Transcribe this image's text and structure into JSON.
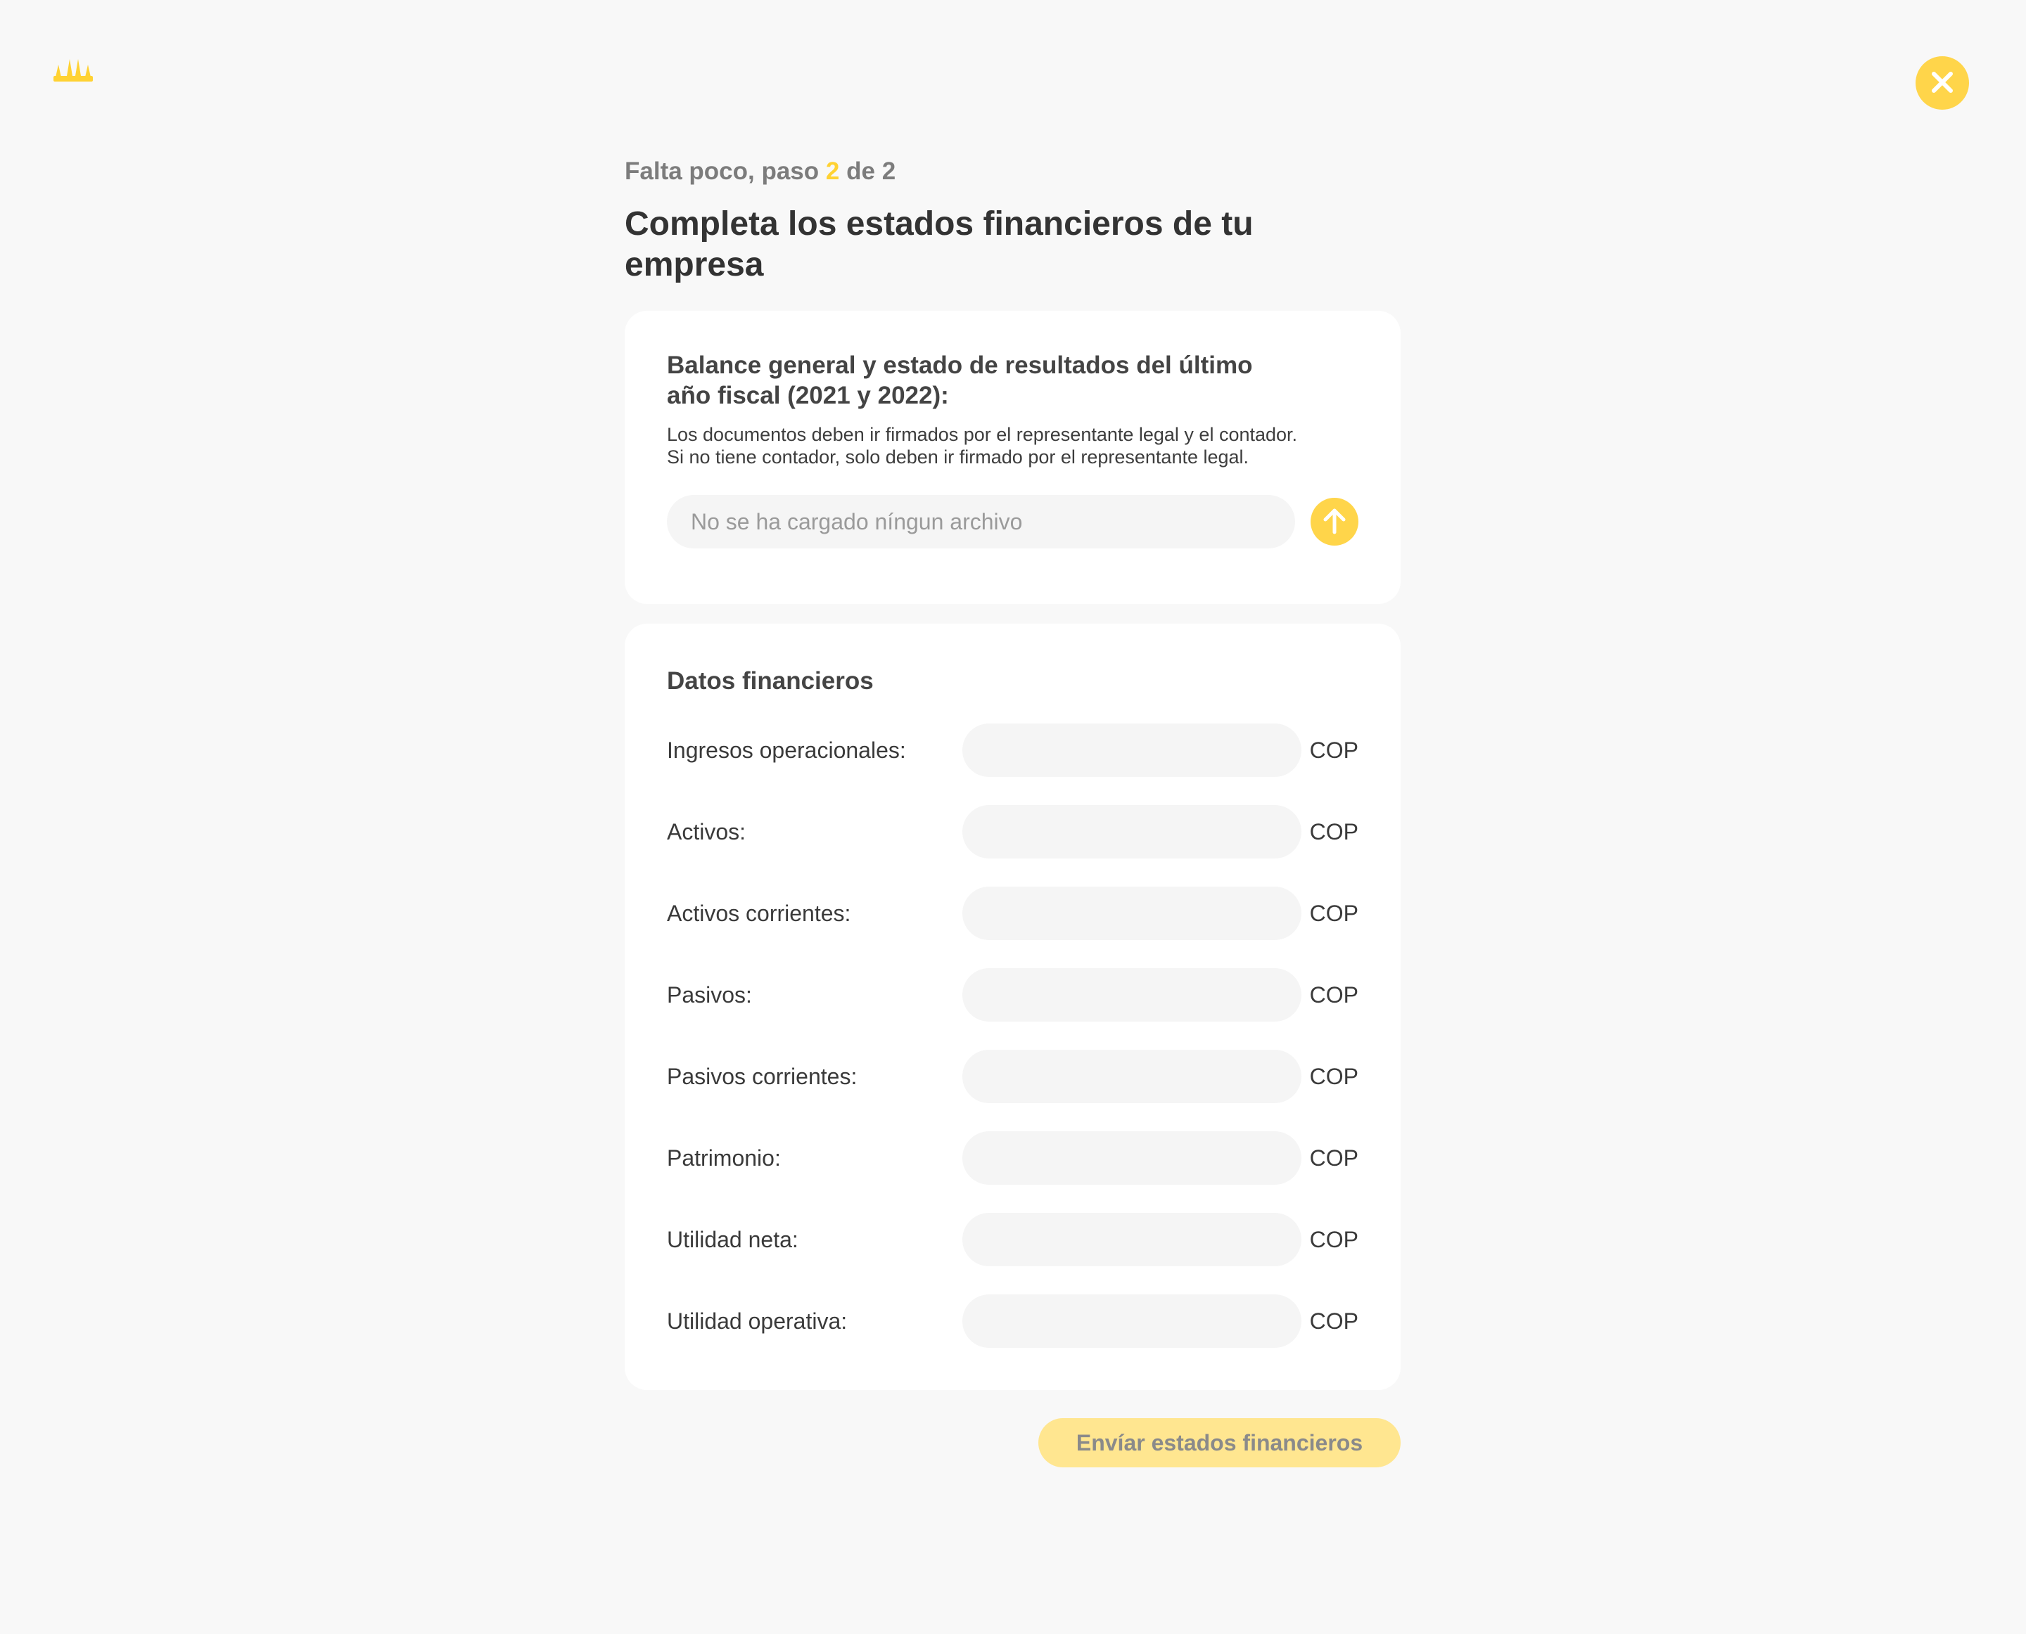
{
  "colors": {
    "accent": "#ffd54a",
    "accent_disabled": "#ffe690",
    "background": "#f8f8f8",
    "card": "#ffffff",
    "field": "#f5f5f5"
  },
  "header": {
    "logo_icon": "crown-logo-icon",
    "close_icon": "close-icon"
  },
  "step": {
    "prefix": "Falta poco, paso",
    "current": "2",
    "separator": "de",
    "total": "2"
  },
  "title": "Completa los estados financieros de tu empresa",
  "upload_card": {
    "title": "Balance general y estado de resultados del último año fiscal (2021 y 2022):",
    "desc_line1": "Los documentos deben ir firmados por el representante legal y el contador.",
    "desc_line2": "Si no tiene contador, solo deben ir firmado por el representante legal.",
    "file_status": "No se ha cargado níngun archivo",
    "upload_icon": "arrow-up-icon"
  },
  "financial_data": {
    "title": "Datos financieros",
    "unit": "COP",
    "fields": [
      {
        "label": "Ingresos operacionales:",
        "value": ""
      },
      {
        "label": "Activos:",
        "value": ""
      },
      {
        "label": "Activos corrientes:",
        "value": ""
      },
      {
        "label": "Pasivos:",
        "value": ""
      },
      {
        "label": "Pasivos corrientes:",
        "value": ""
      },
      {
        "label": "Patrimonio:",
        "value": ""
      },
      {
        "label": "Utilidad neta:",
        "value": ""
      },
      {
        "label": "Utilidad operativa:",
        "value": ""
      }
    ]
  },
  "submit": {
    "label": "Envíar estados financieros"
  }
}
